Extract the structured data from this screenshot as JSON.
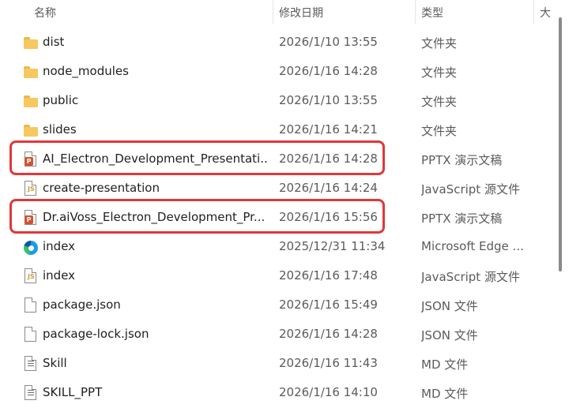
{
  "columns": {
    "name": "名称",
    "date": "修改日期",
    "type": "类型",
    "size": "大"
  },
  "sort_indicator": "^",
  "rows": [
    {
      "name": "dist",
      "date": "2026/1/10 13:55",
      "type": "文件夹",
      "icon": "folder-icon",
      "highlight": false
    },
    {
      "name": "node_modules",
      "date": "2026/1/16 14:28",
      "type": "文件夹",
      "icon": "folder-icon",
      "highlight": false
    },
    {
      "name": "public",
      "date": "2026/1/10 13:55",
      "type": "文件夹",
      "icon": "folder-icon",
      "highlight": false
    },
    {
      "name": "slides",
      "date": "2026/1/16 14:21",
      "type": "文件夹",
      "icon": "folder-icon",
      "highlight": false
    },
    {
      "name": "AI_Electron_Development_Presentati...",
      "date": "2026/1/16 14:28",
      "type": "PPTX 演示文稿",
      "icon": "pptx-file-icon",
      "highlight": true
    },
    {
      "name": "create-presentation",
      "date": "2026/1/16 14:24",
      "type": "JavaScript 源文件",
      "icon": "js-file-icon",
      "highlight": false
    },
    {
      "name": "Dr.aiVoss_Electron_Development_Pr...",
      "date": "2026/1/16 15:56",
      "type": "PPTX 演示文稿",
      "icon": "pptx-file-icon",
      "highlight": true
    },
    {
      "name": "index",
      "date": "2025/12/31 11:34",
      "type": "Microsoft Edge ...",
      "icon": "edge-file-icon",
      "highlight": false
    },
    {
      "name": "index",
      "date": "2026/1/16 17:48",
      "type": "JavaScript 源文件",
      "icon": "js-file-icon",
      "highlight": false
    },
    {
      "name": "package.json",
      "date": "2026/1/16 15:49",
      "type": "JSON 文件",
      "icon": "json-file-icon",
      "highlight": false
    },
    {
      "name": "package-lock.json",
      "date": "2026/1/16 14:28",
      "type": "JSON 文件",
      "icon": "json-file-icon",
      "highlight": false
    },
    {
      "name": "Skill",
      "date": "2026/1/16 11:43",
      "type": "MD 文件",
      "icon": "md-file-icon",
      "highlight": false
    },
    {
      "name": "SKILL_PPT",
      "date": "2026/1/16 14:10",
      "type": "MD 文件",
      "icon": "md-file-icon",
      "highlight": false
    }
  ],
  "colors": {
    "highlight_border": "#e0383b",
    "folder": "#f6c85f",
    "pptx": "#d35230"
  }
}
